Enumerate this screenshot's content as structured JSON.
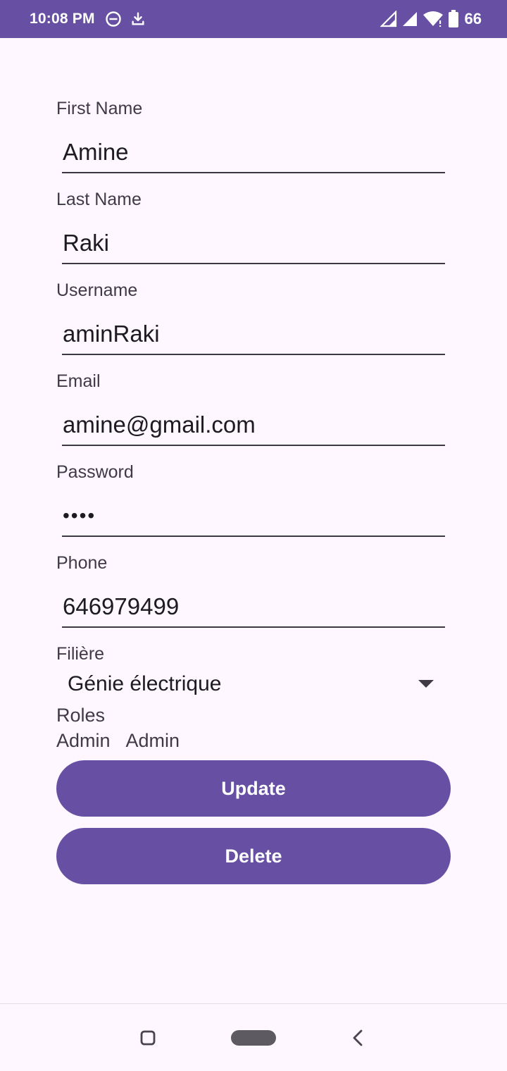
{
  "status_bar": {
    "time": "10:08 PM",
    "battery": "66",
    "icons": [
      "dnd-icon",
      "download-icon",
      "signal-icon",
      "signal-icon",
      "wifi-icon",
      "battery-icon"
    ]
  },
  "form": {
    "first_name": {
      "label": "First Name",
      "value": "Amine"
    },
    "last_name": {
      "label": "Last Name",
      "value": "Raki"
    },
    "username": {
      "label": "Username",
      "value": "aminRaki"
    },
    "email": {
      "label": "Email",
      "value": "amine@gmail.com"
    },
    "password": {
      "label": "Password",
      "value": "••••"
    },
    "phone": {
      "label": "Phone",
      "value": "646979499"
    },
    "filiere": {
      "label": "Filière",
      "selected": "Génie électrique"
    },
    "roles": {
      "label": "Roles",
      "values": [
        "Admin",
        "Admin"
      ]
    }
  },
  "buttons": {
    "update": "Update",
    "delete": "Delete"
  },
  "colors": {
    "primary": "#6750A4",
    "background": "#FEF7FF"
  }
}
